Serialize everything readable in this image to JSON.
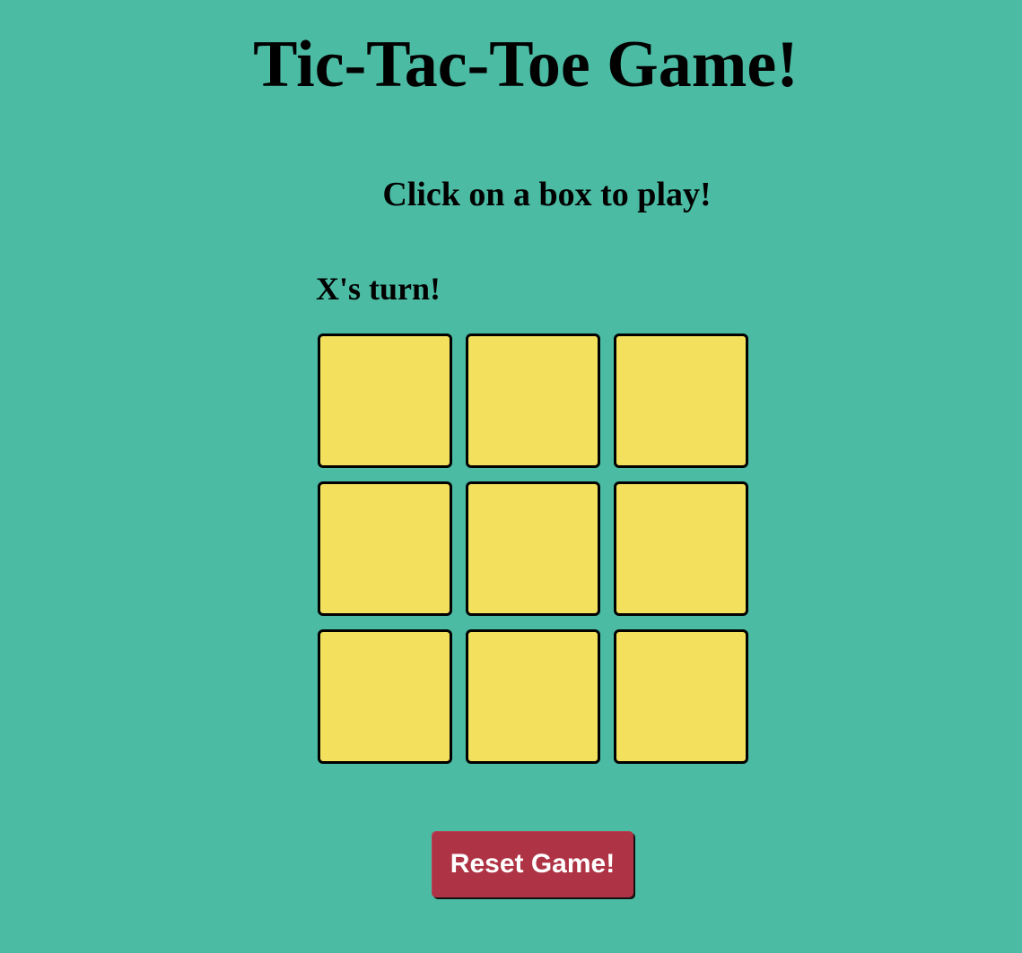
{
  "page": {
    "title": "Tic-Tac-Toe Game!",
    "instruction": "Click on a box to play!",
    "turn_status": "X's turn!"
  },
  "board": {
    "cells": [
      "",
      "",
      "",
      "",
      "",
      "",
      "",
      "",
      ""
    ]
  },
  "controls": {
    "reset_label": "Reset Game!"
  },
  "colors": {
    "background": "#4bbba3",
    "cell_fill": "#f3e15d",
    "cell_border": "#000000",
    "button_fill": "#ae3344",
    "button_text": "#ffffff",
    "text": "#000000"
  }
}
